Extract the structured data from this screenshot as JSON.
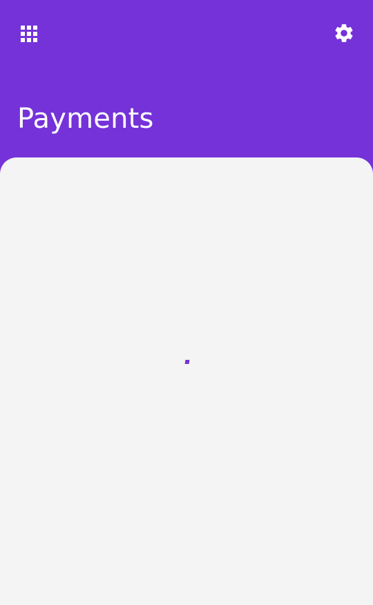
{
  "app": {
    "accent_color": "#7532d9",
    "panel_color": "#f4f4f4"
  },
  "header": {
    "left_icon": "apps-grid-icon",
    "right_icon": "gear-icon",
    "title": "Payments"
  },
  "content": {
    "state": "loading",
    "spinner_icon": "loading-spinner-icon"
  }
}
